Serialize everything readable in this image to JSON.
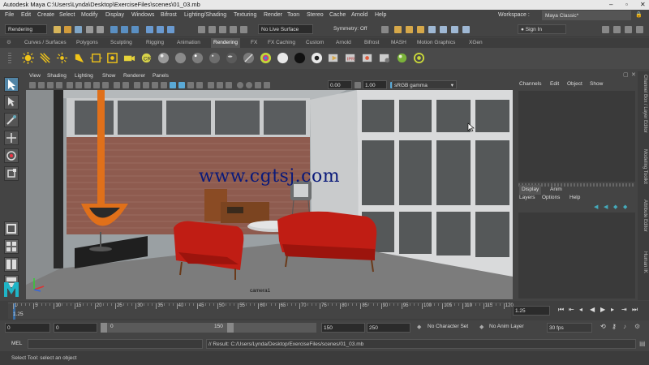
{
  "title_bar": {
    "title": "Autodesk Maya  C:\\Users\\Lynda\\Desktop\\ExerciseFiles\\scenes\\01_03.mb"
  },
  "menu": [
    "File",
    "Edit",
    "Create",
    "Select",
    "Modify",
    "Display",
    "Windows",
    "Bifrost",
    "Lighting/Shading",
    "Texturing",
    "Render",
    "Toon",
    "Stereo",
    "Cache",
    "Arnold",
    "Help"
  ],
  "workspace": {
    "label": "Workspace :",
    "value": "Maya Classic*"
  },
  "status_line": {
    "menu_set": "Rendering",
    "live_surface": "No Live Surface",
    "symmetry": "Symmetry: Off",
    "sign_in": "Sign In"
  },
  "shelf_tabs": [
    "Curves / Surfaces",
    "Polygons",
    "Sculpting",
    "Rigging",
    "Animation",
    "Rendering",
    "FX",
    "FX Caching",
    "Custom",
    "Arnold",
    "Bifrost",
    "MASH",
    "Motion Graphics",
    "XGen"
  ],
  "active_shelf_tab": "Rendering",
  "viewport": {
    "menu": [
      "View",
      "Shading",
      "Lighting",
      "Show",
      "Renderer",
      "Panels"
    ],
    "exposure": "0.00",
    "gamma": "1.00",
    "color_space": "sRGB gamma",
    "camera_label": "camera1",
    "watermark": "www.cgtsj.com"
  },
  "channel_box": {
    "menu": [
      "Channels",
      "Edit",
      "Object",
      "Show"
    ]
  },
  "layer_editor": {
    "tabs": [
      "Display",
      "Anim"
    ],
    "menu": [
      "Layers",
      "Options",
      "Help"
    ]
  },
  "side_tabs": [
    "Channel Box / Layer Editor",
    "Modeling Toolkit",
    "Attribute Editor",
    "Human IK"
  ],
  "timeline": {
    "ticks": [
      "1",
      "5",
      "10",
      "15",
      "20",
      "25",
      "30",
      "35",
      "40",
      "45",
      "50",
      "55",
      "60",
      "65",
      "70",
      "75",
      "80",
      "85",
      "90",
      "95",
      "100",
      "105",
      "110",
      "115",
      "120"
    ],
    "current_frame": "1.25",
    "current_frame_right": "1.25"
  },
  "range": {
    "start": "0",
    "anim_start": "0",
    "slider_start": "0",
    "slider_end": "150",
    "playback_end": "150",
    "anim_end": "250",
    "character_set": "No Character Set",
    "anim_layer": "No Anim Layer",
    "fps": "30 fps"
  },
  "command_line": {
    "label": "MEL",
    "result": "// Result: C:/Users/Lynda/Desktop/ExerciseFiles/scenes/01_03.mb"
  },
  "help_line": "Select Tool: select an object",
  "colors": {
    "panel": "#444444",
    "accent": "#5285a6",
    "wall": "#d9d9d9",
    "brick": "#9a5a4e",
    "fireplace": "#e0701a",
    "sofa": "#c01d14"
  }
}
